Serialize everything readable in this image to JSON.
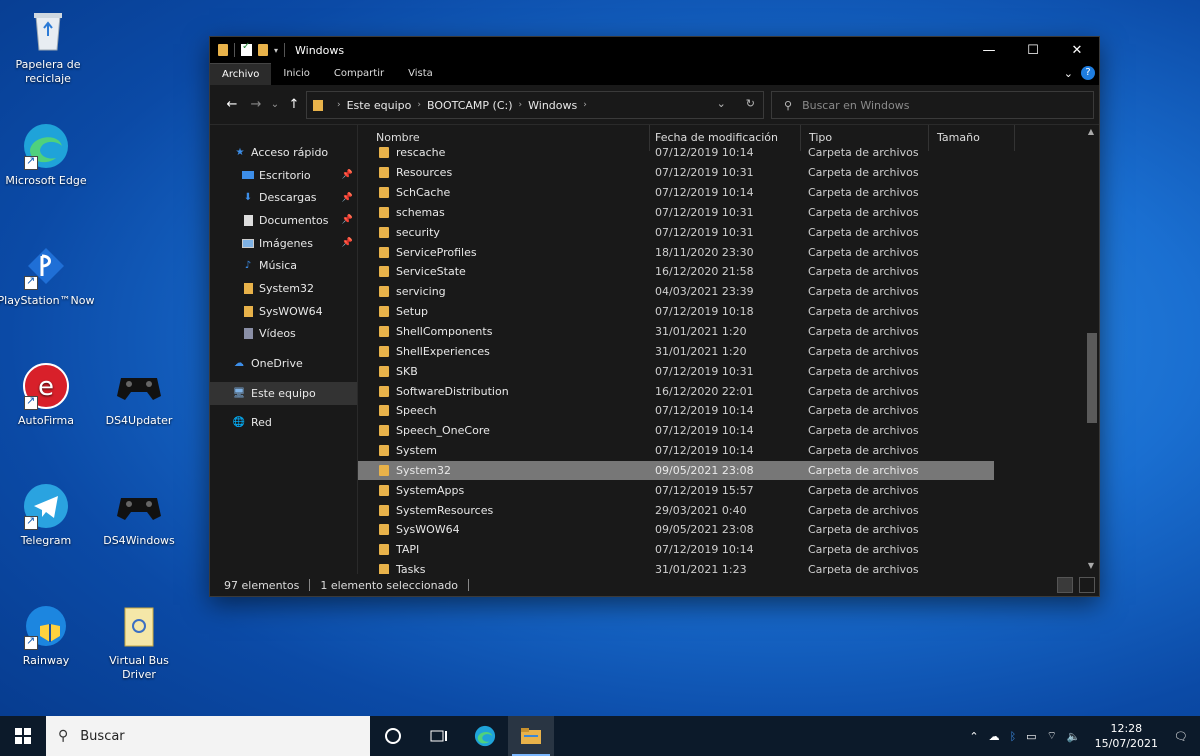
{
  "desktop": {
    "icons": [
      {
        "label": "Papelera de reciclaje"
      },
      {
        "label": "Microsoft Edge"
      },
      {
        "label": "PlayStation™Now"
      },
      {
        "label": "AutoFirma"
      },
      {
        "label": "DS4Updater"
      },
      {
        "label": "Telegram"
      },
      {
        "label": "DS4Windows"
      },
      {
        "label": "Rainway"
      },
      {
        "label": "Virtual Bus Driver"
      }
    ]
  },
  "window": {
    "title": "Windows",
    "ribbon_tabs": [
      "Archivo",
      "Inicio",
      "Compartir",
      "Vista"
    ],
    "address": [
      "Este equipo",
      "BOOTCAMP (C:)",
      "Windows"
    ],
    "search_placeholder": "Buscar en Windows",
    "columns": [
      "Nombre",
      "Fecha de modificación",
      "Tipo",
      "Tamaño"
    ],
    "nav": [
      {
        "label": "Acceso rápido",
        "icon": "star-icon",
        "pinned": false
      },
      {
        "label": "Escritorio",
        "icon": "desktop-icon",
        "pinned": true
      },
      {
        "label": "Descargas",
        "icon": "download-icon",
        "pinned": true
      },
      {
        "label": "Documentos",
        "icon": "document-icon",
        "pinned": true
      },
      {
        "label": "Imágenes",
        "icon": "pictures-icon",
        "pinned": true
      },
      {
        "label": "Música",
        "icon": "music-icon",
        "pinned": false
      },
      {
        "label": "System32",
        "icon": "folder-icon",
        "pinned": false
      },
      {
        "label": "SysWOW64",
        "icon": "folder-icon",
        "pinned": false
      },
      {
        "label": "Vídeos",
        "icon": "video-icon",
        "pinned": false
      },
      {
        "label": "OneDrive",
        "icon": "cloud-icon",
        "pinned": false
      },
      {
        "label": "Este equipo",
        "icon": "computer-icon",
        "pinned": false
      },
      {
        "label": "Red",
        "icon": "network-icon",
        "pinned": false
      }
    ],
    "files": [
      {
        "name": "rescache",
        "date": "07/12/2019 10:14",
        "type": "Carpeta de archivos"
      },
      {
        "name": "Resources",
        "date": "07/12/2019 10:31",
        "type": "Carpeta de archivos"
      },
      {
        "name": "SchCache",
        "date": "07/12/2019 10:14",
        "type": "Carpeta de archivos"
      },
      {
        "name": "schemas",
        "date": "07/12/2019 10:31",
        "type": "Carpeta de archivos"
      },
      {
        "name": "security",
        "date": "07/12/2019 10:31",
        "type": "Carpeta de archivos"
      },
      {
        "name": "ServiceProfiles",
        "date": "18/11/2020 23:30",
        "type": "Carpeta de archivos"
      },
      {
        "name": "ServiceState",
        "date": "16/12/2020 21:58",
        "type": "Carpeta de archivos"
      },
      {
        "name": "servicing",
        "date": "04/03/2021 23:39",
        "type": "Carpeta de archivos"
      },
      {
        "name": "Setup",
        "date": "07/12/2019 10:18",
        "type": "Carpeta de archivos"
      },
      {
        "name": "ShellComponents",
        "date": "31/01/2021 1:20",
        "type": "Carpeta de archivos"
      },
      {
        "name": "ShellExperiences",
        "date": "31/01/2021 1:20",
        "type": "Carpeta de archivos"
      },
      {
        "name": "SKB",
        "date": "07/12/2019 10:31",
        "type": "Carpeta de archivos"
      },
      {
        "name": "SoftwareDistribution",
        "date": "16/12/2020 22:01",
        "type": "Carpeta de archivos"
      },
      {
        "name": "Speech",
        "date": "07/12/2019 10:14",
        "type": "Carpeta de archivos"
      },
      {
        "name": "Speech_OneCore",
        "date": "07/12/2019 10:14",
        "type": "Carpeta de archivos"
      },
      {
        "name": "System",
        "date": "07/12/2019 10:14",
        "type": "Carpeta de archivos"
      },
      {
        "name": "System32",
        "date": "09/05/2021 23:08",
        "type": "Carpeta de archivos",
        "selected": true
      },
      {
        "name": "SystemApps",
        "date": "07/12/2019 15:57",
        "type": "Carpeta de archivos"
      },
      {
        "name": "SystemResources",
        "date": "29/03/2021 0:40",
        "type": "Carpeta de archivos"
      },
      {
        "name": "SysWOW64",
        "date": "09/05/2021 23:08",
        "type": "Carpeta de archivos"
      },
      {
        "name": "TAPI",
        "date": "07/12/2019 10:14",
        "type": "Carpeta de archivos"
      },
      {
        "name": "Tasks",
        "date": "31/01/2021 1:23",
        "type": "Carpeta de archivos"
      }
    ],
    "status": {
      "count": "97 elementos",
      "selection": "1 elemento seleccionado"
    }
  },
  "taskbar": {
    "search_placeholder": "Buscar",
    "time": "12:28",
    "date": "15/07/2021"
  },
  "colors": {
    "folder": "#e8b24a",
    "accent": "#1e7de0"
  }
}
